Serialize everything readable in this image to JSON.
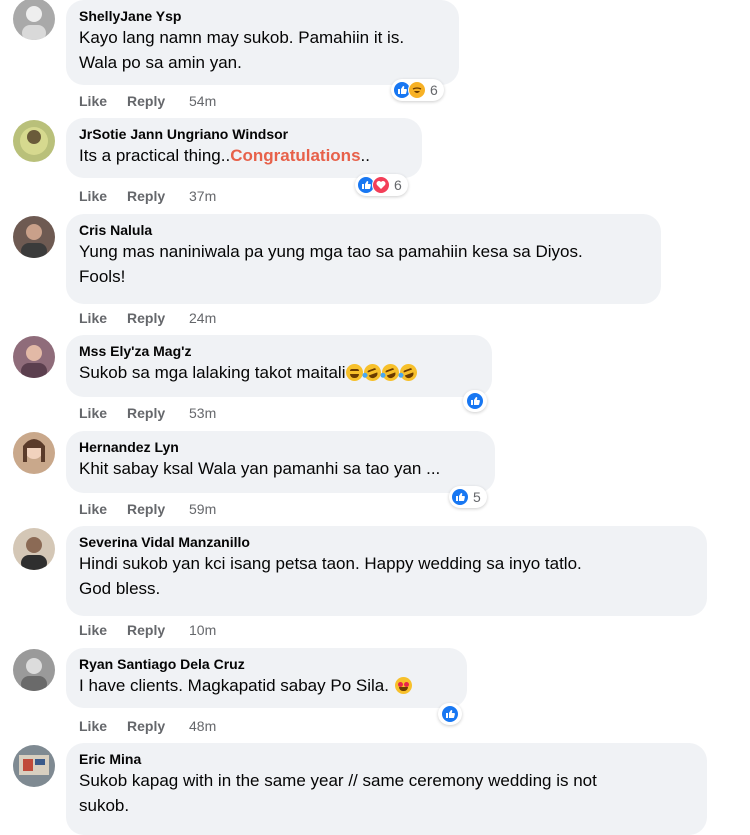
{
  "comments": [
    {
      "name": "ShellyJane Ysp",
      "text": "Kayo lang namn may sukob. Pamahiin it is.\nWala po sa amin yan.",
      "like": "Like",
      "reply": "Reply",
      "time": "54m",
      "reactions": "6",
      "avatar_color": "#a9a9a9"
    },
    {
      "name": "JrSotie Jann Ungriano Windsor",
      "text": "Its a practical thing..",
      "highlight": "Congratulations",
      "suffix": "..",
      "like": "Like",
      "reply": "Reply",
      "time": "37m",
      "reactions": "6",
      "avatar_color": "#b9c07a"
    },
    {
      "name": "Cris Nalula",
      "text": "Yung mas naniniwala pa yung mga tao sa pamahiin kesa sa Diyos.\nFools!",
      "like": "Like",
      "reply": "Reply",
      "time": "24m",
      "avatar_color": "#6e5a52"
    },
    {
      "name": "Mss Ely'za Mag'z",
      "text": "Sukob sa mga lalaking takot maitali",
      "like": "Like",
      "reply": "Reply",
      "time": "53m",
      "avatar_color": "#8f6c7a"
    },
    {
      "name": "Hernandez Lyn",
      "text": "Khit sabay ksal Wala yan pamanhi sa tao yan ...",
      "like": "Like",
      "reply": "Reply",
      "time": "59m",
      "reactions": "5",
      "avatar_color": "#c9a88b"
    },
    {
      "name": "Severina Vidal Manzanillo",
      "text": "Hindi sukob yan kci isang petsa taon. Happy wedding sa inyo tatlo.\nGod bless.",
      "like": "Like",
      "reply": "Reply",
      "time": "10m",
      "avatar_color": "#d4c7b6"
    },
    {
      "name": "Ryan Santiago Dela Cruz",
      "text": "I have clients. Magkapatid sabay Po Sila.",
      "like": "Like",
      "reply": "Reply",
      "time": "48m",
      "avatar_color": "#9a9a9a"
    },
    {
      "name": "Eric Mina",
      "text": "Sukob kapag with in the same year // same ceremony wedding is not\nsukob.",
      "avatar_color": "#7f8a92"
    }
  ]
}
